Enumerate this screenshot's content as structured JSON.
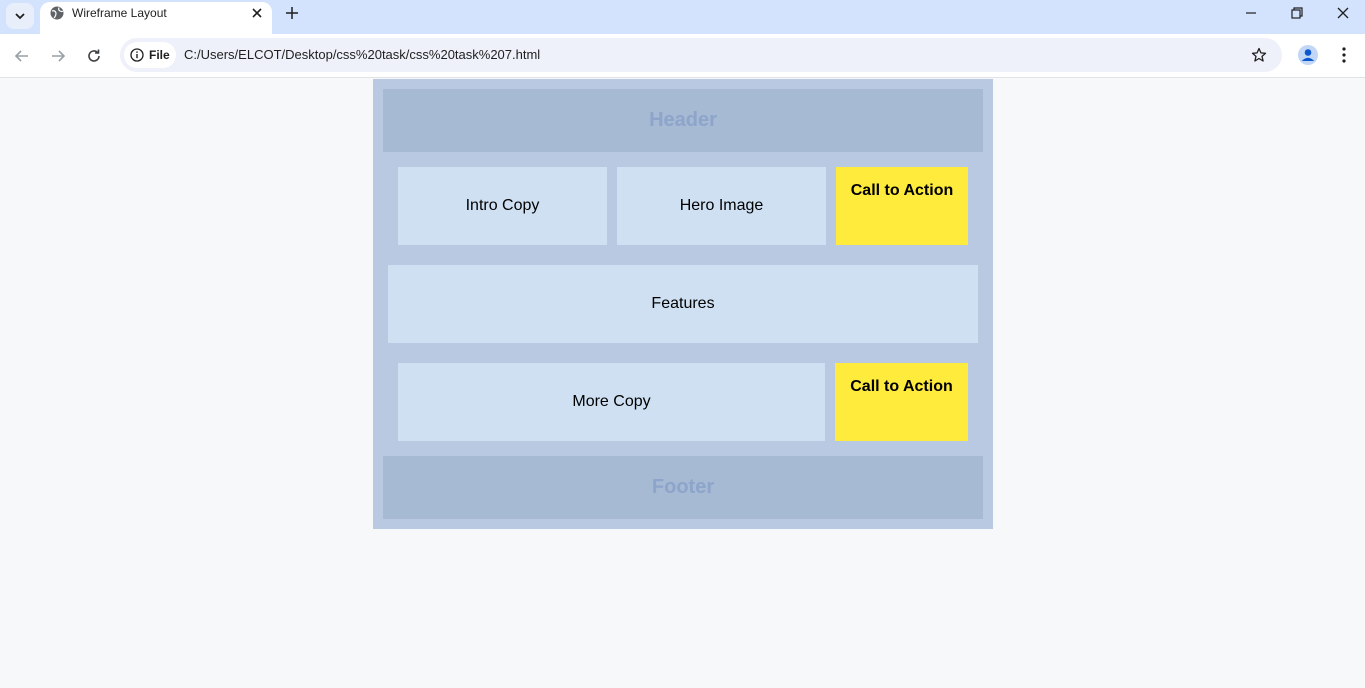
{
  "browser": {
    "tab_title": "Wireframe Layout",
    "site_chip_label": "File",
    "url": "C:/Users/ELCOT/Desktop/css%20task/css%20task%207.html"
  },
  "page": {
    "header": "Header",
    "intro_copy": "Intro Copy",
    "hero_image": "Hero Image",
    "cta_top": "Call to Action",
    "features": "Features",
    "more_copy": "More Copy",
    "cta_bottom": "Call to Action",
    "footer": "Footer"
  },
  "colors": {
    "container": "#b8c9e1",
    "band": "#a6bad4",
    "band_text": "#8da4cb",
    "block": "#cfe0f3",
    "cta": "#ffeb3b"
  }
}
